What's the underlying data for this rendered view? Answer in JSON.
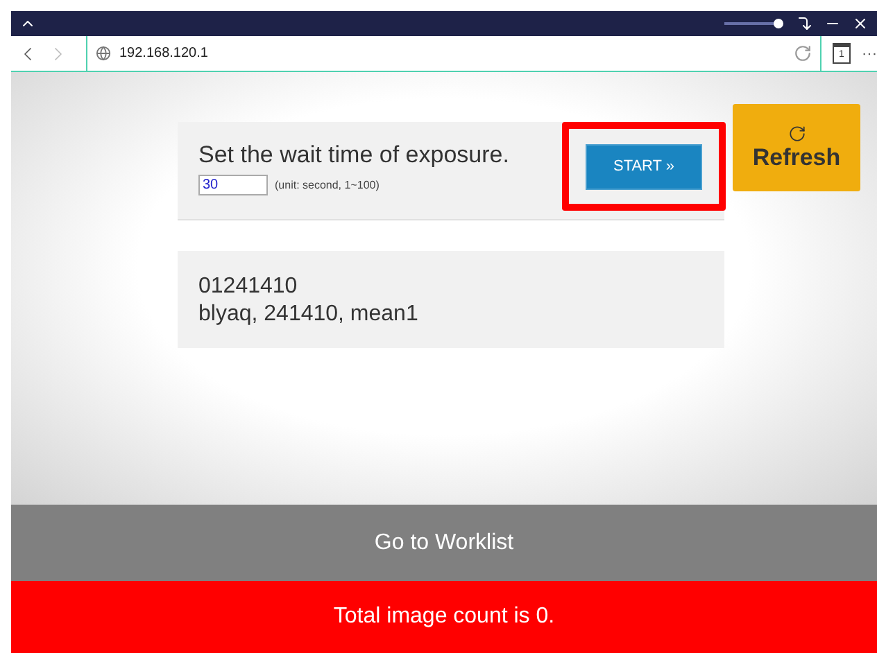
{
  "browser": {
    "url": "192.168.120.1",
    "tab_count": "1",
    "menu": "···"
  },
  "exposure": {
    "prompt": "Set the wait time of exposure.",
    "value": "30",
    "hint": "(unit: second, 1~100)",
    "start_button": "START »",
    "highlighted": true
  },
  "refresh_button": "Refresh",
  "info_lines": [
    "01241410",
    "blyaq, 241410, mean1"
  ],
  "worklist_button": "Go to Worklist",
  "status": "Total image count is 0."
}
